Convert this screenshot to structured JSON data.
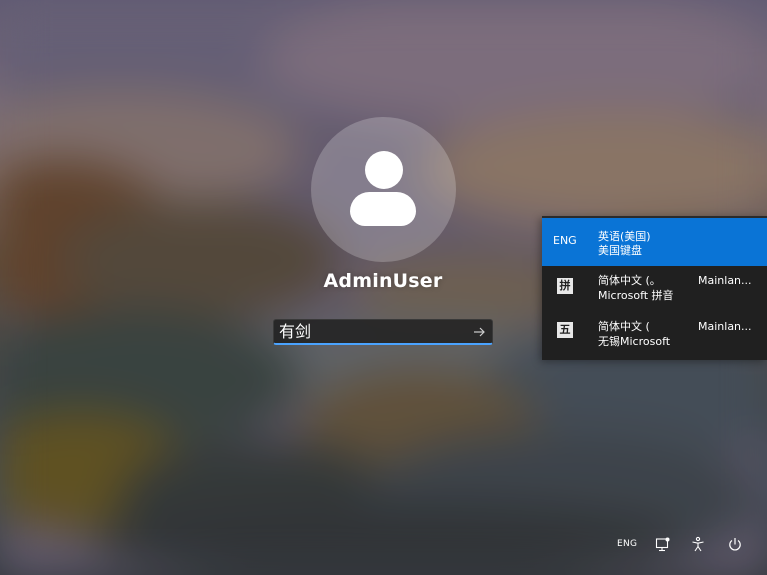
{
  "user": {
    "name": "AdminUser"
  },
  "password": {
    "value": "有剑"
  },
  "ime_menu": {
    "items": [
      {
        "short": "ENG",
        "line1": "英语(美国)",
        "line2": "美国键盘",
        "side": "",
        "selected": true
      },
      {
        "short": "拼",
        "line1": "简体中文 (。",
        "line2": "Microsoft 拼音",
        "side": "Mainlan...",
        "selected": false
      },
      {
        "short": "五",
        "line1": "简体中文 (",
        "line2": "无锡Microsoft",
        "side": "Mainlan...",
        "selected": false
      }
    ]
  },
  "tray": {
    "language": "ENG",
    "icons": [
      "network-icon",
      "accessibility-icon",
      "power-icon"
    ]
  },
  "colors": {
    "accent": "#0a74d6",
    "input_focus": "#4aa3ff",
    "menu_background": "#202020"
  }
}
